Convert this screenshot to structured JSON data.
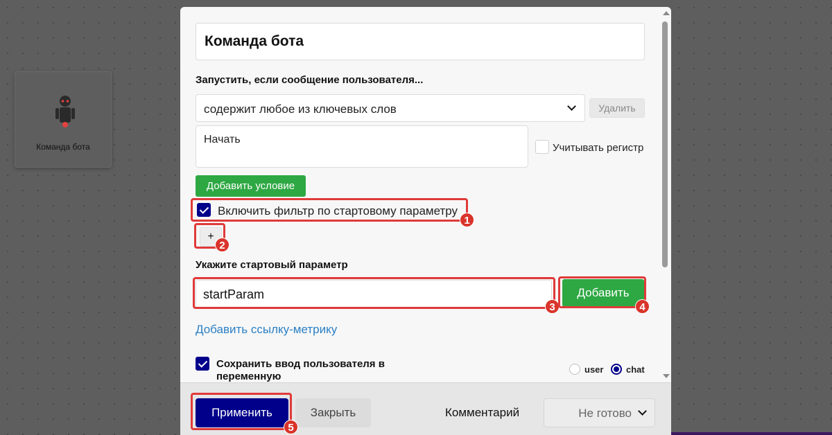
{
  "background": {
    "node_label": "Команда бота"
  },
  "modal": {
    "title_value": "Команда бота",
    "trigger_label": "Запустить, если сообщение пользователя...",
    "condition_select": "содержит любое из ключевых слов",
    "delete_label": "Удалить",
    "keywords_value": "Начать",
    "case_sensitive_label": "Учитывать регистр",
    "case_sensitive_checked": false,
    "add_condition_label": "Добавить условие",
    "start_filter_label": "Включить фильтр по стартовому параметру",
    "start_filter_checked": true,
    "plus_label": "+",
    "start_param_label": "Укажите стартовый параметр",
    "start_param_value": "startParam",
    "add_label": "Добавить",
    "metric_link_label": "Добавить ссылку-метрику",
    "save_input_label": "Сохранить ввод пользователя в переменную",
    "save_input_checked": true,
    "scope_options": [
      "user",
      "chat"
    ],
    "scope_selected": "chat"
  },
  "footer": {
    "apply_label": "Применить",
    "close_label": "Закрыть",
    "comment_label": "Комментарий",
    "status_value": "Не готово"
  },
  "annotations": {
    "badge_1": "1",
    "badge_2": "2",
    "badge_3": "3",
    "badge_4": "4",
    "badge_5": "5",
    "highlight_color": "#e03a3a"
  },
  "colors": {
    "primary": "#00008b",
    "success": "#2ea843",
    "link": "#2b7fc4"
  }
}
